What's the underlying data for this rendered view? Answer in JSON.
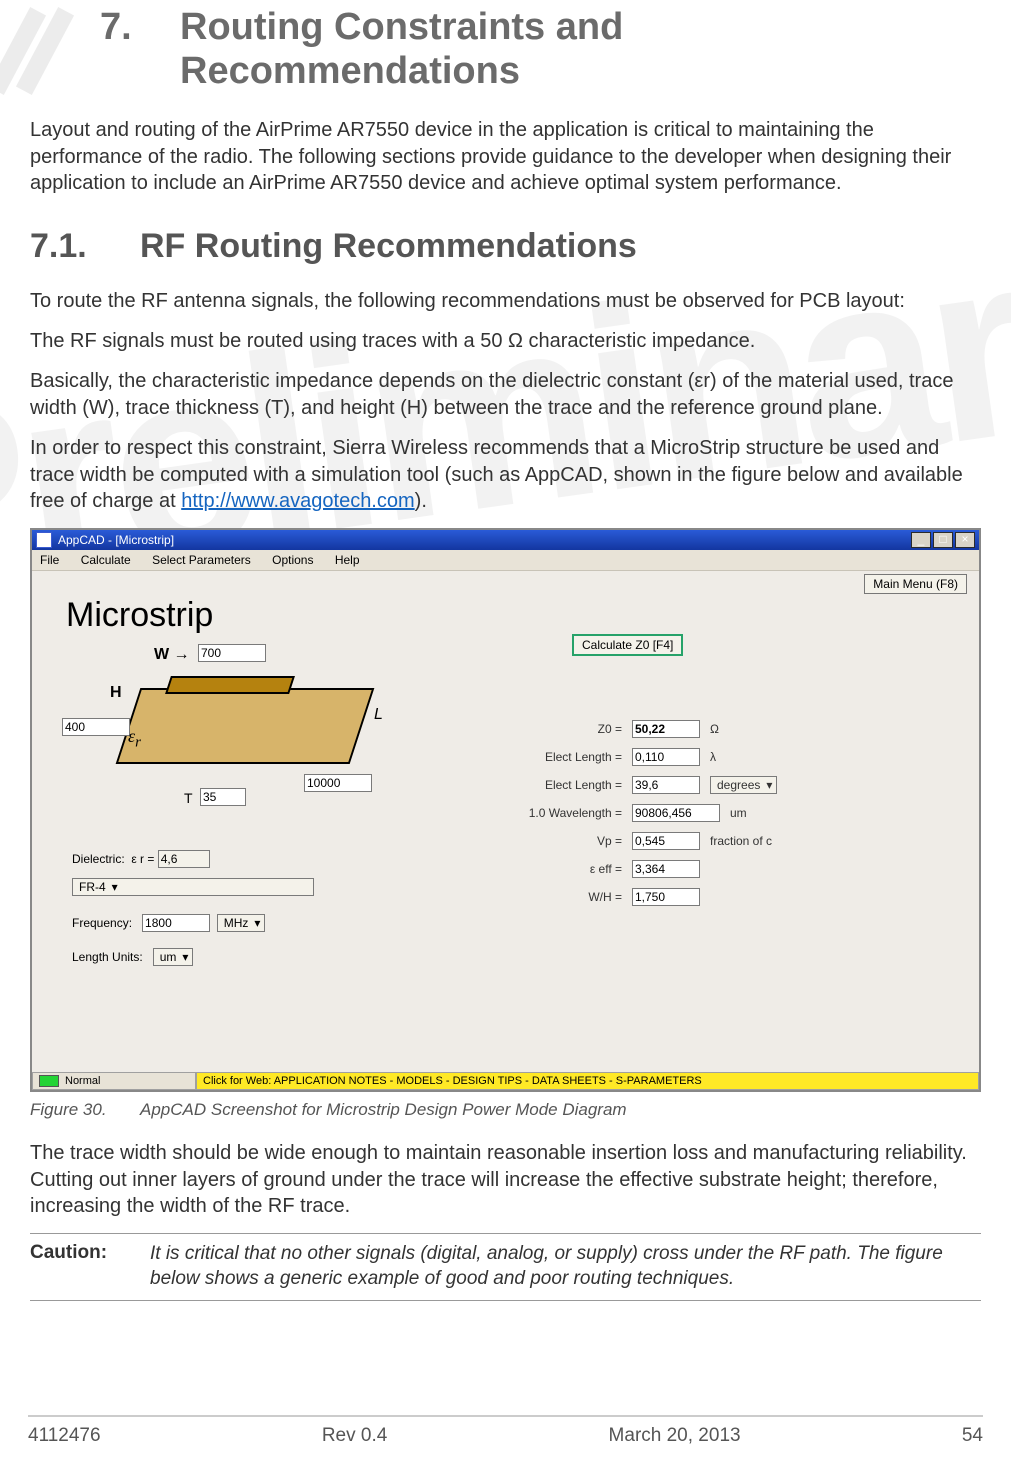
{
  "chapter": {
    "num": "7.",
    "title_l1": "Routing Constraints and",
    "title_l2": "Recommendations"
  },
  "intro": "Layout and routing of the AirPrime AR7550 device in the application is critical to maintaining the performance of the radio. The following sections provide guidance to the developer when designing their application to include an AirPrime AR7550 device and achieve optimal system performance.",
  "sec71": {
    "num": "7.1.",
    "title": "RF Routing Recommendations"
  },
  "p1": "To route the RF antenna signals, the following recommendations must be observed for PCB layout:",
  "p2": "The RF signals must be routed using traces with a 50 Ω characteristic impedance.",
  "p3": "Basically, the characteristic impedance depends on the dielectric constant (εr) of the material used, trace width (W), trace thickness (T), and height (H) between the trace and the reference ground plane.",
  "p4a": "In order to respect this constraint, Sierra Wireless recommends that a MicroStrip structure be used and trace width be computed with a simulation tool (such as AppCAD, shown in the figure below and available free of charge at ",
  "p4link": "http://www.avagotech.com",
  "p4b": ").",
  "appcad": {
    "wintitle": "AppCAD - [Microstrip]",
    "menu": [
      "File",
      "Calculate",
      "Select Parameters",
      "Options",
      "Help"
    ],
    "mainmenu": "Main Menu (F8)",
    "calcbtn": "Calculate Z0  [F4]",
    "heading": "Microstrip",
    "W": "700",
    "H": "400",
    "T": "35",
    "L": "10000",
    "er_lbl": "ε r =",
    "er": "4,6",
    "dielectric_lbl": "Dielectric:",
    "dielectric": "FR-4",
    "freq_lbl": "Frequency:",
    "freq": "1800",
    "freq_unit": "MHz",
    "lenunits_lbl": "Length Units:",
    "lenunits": "um",
    "res": {
      "z0_l": "Z0 =",
      "z0": "50,22",
      "z0_u": "Ω",
      "el1_l": "Elect Length =",
      "el1": "0,110",
      "el1_u": "λ",
      "el2_l": "Elect Length =",
      "el2": "39,6",
      "el2_u": "degrees",
      "wav_l": "1.0 Wavelength =",
      "wav": "90806,456",
      "wav_u": "um",
      "vp_l": "Vp =",
      "vp": "0,545",
      "vp_u": "fraction of c",
      "eeff_l": "ε eff =",
      "eeff": "3,364",
      "wh_l": "W/H =",
      "wh": "1,750"
    },
    "status_l": "Normal",
    "status_r": "Click for Web: APPLICATION NOTES - MODELS - DESIGN TIPS - DATA SHEETS - S-PARAMETERS"
  },
  "figcap": {
    "num": "Figure 30.",
    "text": "AppCAD Screenshot for Microstrip Design Power Mode Diagram"
  },
  "p5": "The trace width should be wide enough to maintain reasonable insertion loss and manufacturing reliability. Cutting out inner layers of ground under the trace will increase the effective substrate height; therefore, increasing the width of the RF trace.",
  "caution": {
    "label": "Caution:",
    "text": "It is critical that no other signals (digital, analog, or supply) cross under the RF path. The figure below shows a generic example of good and poor routing techniques."
  },
  "footer": {
    "doc": "4112476",
    "rev": "Rev 0.4",
    "date": "March 20, 2013",
    "page": "54"
  },
  "watermark": "Preliminary"
}
